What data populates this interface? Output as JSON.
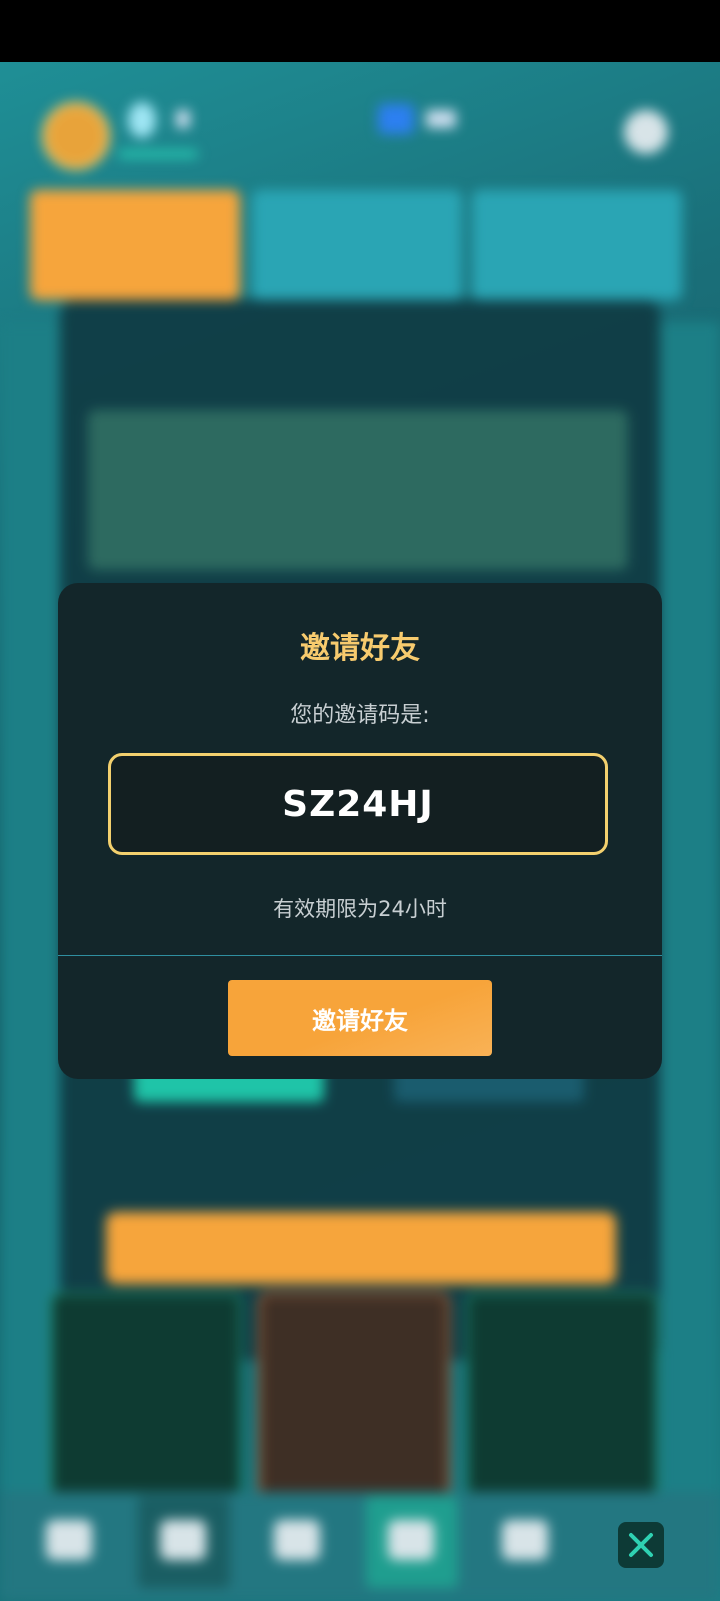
{
  "dialog": {
    "title": "邀请好友",
    "code_label": "您的邀请码是:",
    "invite_code": "SZ24HJ",
    "expiry_text": "有效期限为24小时",
    "invite_button_label": "邀请好友"
  },
  "colors": {
    "accent_gold": "#f7cb6e",
    "button_orange": "#f7a43a",
    "dialog_bg": "#13262a",
    "close_green": "#2fd1b2"
  },
  "icons": {
    "close": "close-icon"
  }
}
